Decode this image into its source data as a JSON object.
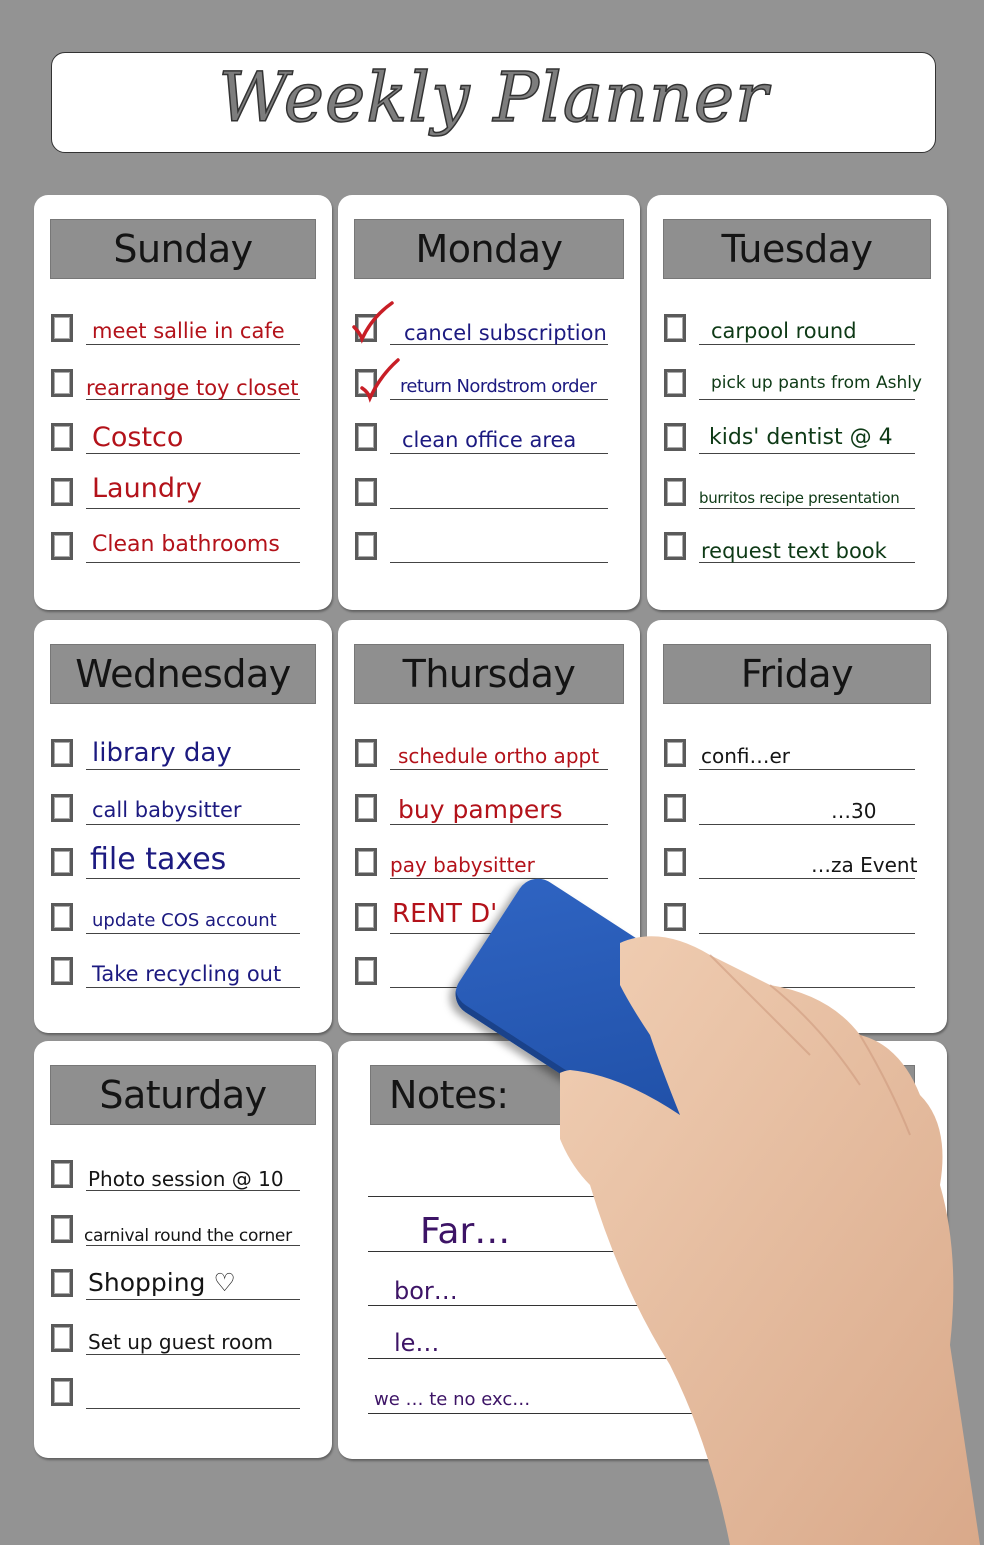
{
  "title": "Weekly Planner",
  "colors": {
    "background": "#939393",
    "header_bar": "#8f8f8f",
    "red_ink": "#b3121a",
    "blue_ink": "#1c1a80",
    "green_ink": "#0e3a16",
    "black_ink": "#151515",
    "purple_ink": "#3d1466",
    "check_mark": "#c81e26",
    "eraser": "#2a5cb8"
  },
  "days": [
    {
      "name": "Sunday",
      "ink": "red",
      "items": [
        {
          "text": "meet sallie in cafe",
          "checked": false
        },
        {
          "text": "rearrange toy closet",
          "checked": false
        },
        {
          "text": "Costco",
          "checked": false
        },
        {
          "text": "Laundry",
          "checked": false
        },
        {
          "text": "Clean bathrooms",
          "checked": false
        }
      ]
    },
    {
      "name": "Monday",
      "ink": "blue",
      "items": [
        {
          "text": "cancel subscription",
          "checked": true
        },
        {
          "text": "return Nordstrom order",
          "checked": true
        },
        {
          "text": "clean office area",
          "checked": false
        },
        {
          "text": "",
          "checked": false
        },
        {
          "text": "",
          "checked": false
        }
      ]
    },
    {
      "name": "Tuesday",
      "ink": "green",
      "items": [
        {
          "text": "carpool round",
          "checked": false
        },
        {
          "text": "pick up pants from Ashly",
          "checked": false
        },
        {
          "text": "kids' dentist @ 4",
          "checked": false
        },
        {
          "text": "burritos recipe presentation",
          "checked": false
        },
        {
          "text": "request text book",
          "checked": false
        }
      ]
    },
    {
      "name": "Wednesday",
      "ink": "blue",
      "items": [
        {
          "text": "library day",
          "checked": false
        },
        {
          "text": "call babysitter",
          "checked": false
        },
        {
          "text": "file taxes",
          "checked": false
        },
        {
          "text": "update COS account",
          "checked": false
        },
        {
          "text": "Take recycling out",
          "checked": false
        }
      ]
    },
    {
      "name": "Thursday",
      "ink": "red",
      "items": [
        {
          "text": "schedule ortho appt",
          "checked": false
        },
        {
          "text": "buy pampers",
          "checked": false
        },
        {
          "text": "pay babysitter",
          "checked": false
        },
        {
          "text": "RENT D'",
          "checked": false
        },
        {
          "text": "",
          "checked": false
        }
      ]
    },
    {
      "name": "Friday",
      "ink": "black",
      "items": [
        {
          "text": "confi…er",
          "checked": false
        },
        {
          "text": "…30",
          "checked": false
        },
        {
          "text": "…za Event",
          "checked": false
        },
        {
          "text": "",
          "checked": false
        },
        {
          "text": "",
          "checked": false
        }
      ]
    },
    {
      "name": "Saturday",
      "ink": "black",
      "items": [
        {
          "text": "Photo session @ 10",
          "checked": false
        },
        {
          "text": "carnival round the corner",
          "checked": false
        },
        {
          "text": "Shopping ♡",
          "checked": false
        },
        {
          "text": "Set up guest room",
          "checked": false
        },
        {
          "text": "",
          "checked": false
        }
      ]
    }
  ],
  "notes": {
    "title": "Notes:",
    "lines": [
      "",
      "Far…",
      "bor…",
      "le…",
      "we … te no exc…"
    ]
  }
}
